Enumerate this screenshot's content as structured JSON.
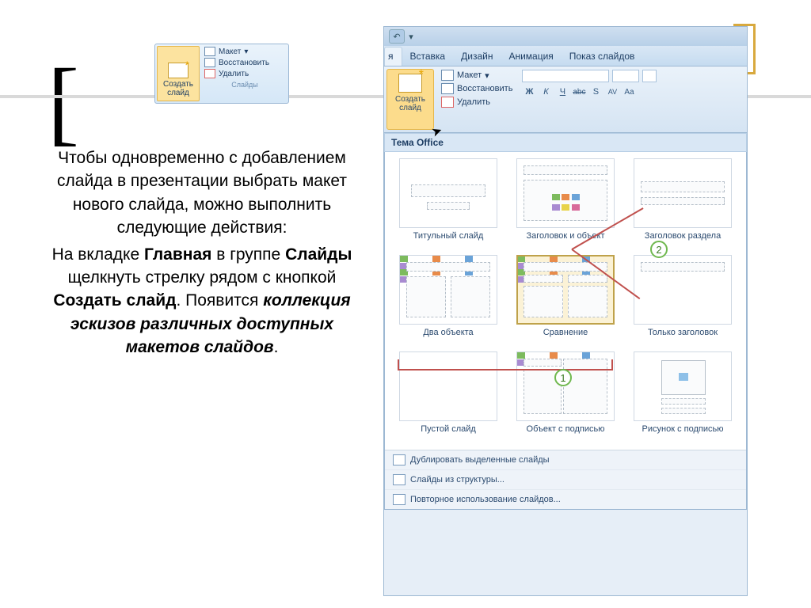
{
  "snippet": {
    "new_slide": "Создать слайд",
    "layout": "Макет",
    "reset": "Восстановить",
    "delete": "Удалить",
    "group": "Слайды"
  },
  "text": {
    "p1": "Чтобы одновременно с добавлением слайда в презентации выбрать макет нового слайда, можно выполнить следующие действия:",
    "p2a": "На вкладке ",
    "p2b": "Главная",
    "p2c": " в группе ",
    "p2d": "Слайды",
    "p2e": " щелкнуть стрелку рядом с кнопкой ",
    "p2f": "Создать слайд",
    "p2g": ". Появится ",
    "p2h": "коллекция эскизов различных доступных макетов слайдов",
    "p2i": "."
  },
  "ppt": {
    "tabs": {
      "home_partial": "я",
      "insert": "Вставка",
      "design": "Дизайн",
      "anim": "Анимация",
      "show": "Показ слайдов"
    },
    "ribbon": {
      "new_slide": "Создать слайд",
      "layout": "Макет",
      "reset": "Восстановить",
      "delete": "Удалить"
    },
    "font": {
      "b": "Ж",
      "i": "К",
      "u": "Ч",
      "strike": "abc",
      "shadow": "S",
      "spacing": "AV",
      "case": "Aa"
    },
    "gallery_title": "Тема Office",
    "layouts": {
      "title": "Титульный слайд",
      "title_content": "Заголовок и объект",
      "section": "Заголовок раздела",
      "two": "Два объекта",
      "compare": "Сравнение",
      "only_title": "Только заголовок",
      "blank": "Пустой слайд",
      "obj_caption": "Объект с подписью",
      "pic_caption": "Рисунок с подписью"
    },
    "footer": {
      "dup": "Дублировать выделенные слайды",
      "outline": "Слайды из структуры...",
      "reuse": "Повторное использование слайдов..."
    },
    "callouts": {
      "one": "1",
      "two": "2"
    }
  }
}
